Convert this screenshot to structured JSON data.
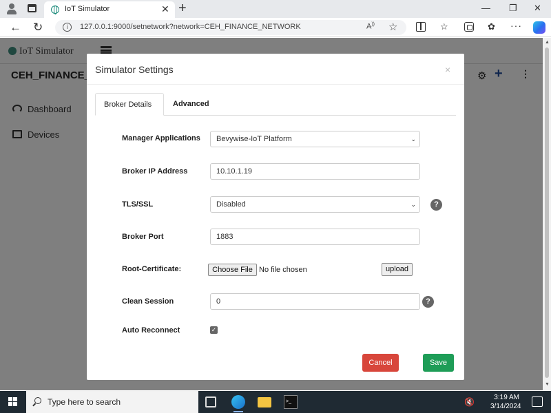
{
  "browser": {
    "tab_title": "IoT Simulator",
    "url": "127.0.0.1:9000/setnetwork?network=CEH_FINANCE_NETWORK",
    "icons": [
      "profile-icon",
      "tab-actions-icon",
      "globe-icon",
      "close-icon",
      "new-tab-icon",
      "minimize-icon",
      "maximize-icon",
      "window-close-icon",
      "back-icon",
      "refresh-icon",
      "site-info-icon",
      "read-aloud-icon",
      "favorite-star-icon",
      "split-screen-icon",
      "favorites-icon",
      "collections-icon",
      "extensions-icon",
      "more-icon",
      "copilot-icon"
    ]
  },
  "app": {
    "logo": "IoT Simulator",
    "network_title": "CEH_FINANCE_",
    "sidebar": [
      {
        "label": "Dashboard",
        "icon": "dashboard-icon"
      },
      {
        "label": "Devices",
        "icon": "monitor-icon"
      }
    ]
  },
  "modal": {
    "title": "Simulator Settings",
    "close": "×",
    "tabs": [
      {
        "label": "Broker Details",
        "active": true
      },
      {
        "label": "Advanced",
        "active": false
      }
    ],
    "fields": {
      "manager_label": "Manager Applications",
      "manager_value": "Bevywise-IoT Platform",
      "broker_ip_label": "Broker IP Address",
      "broker_ip_value": "10.10.1.19",
      "tls_label": "TLS/SSL",
      "tls_value": "Disabled",
      "port_label": "Broker Port",
      "port_value": "1883",
      "root_cert_label": "Root-Certificate:",
      "choose_file": "Choose File",
      "no_file": "No file chosen",
      "upload": "upload",
      "clean_session_label": "Clean Session",
      "clean_session_value": "0",
      "auto_reconnect_label": "Auto Reconnect",
      "auto_reconnect_checked": true,
      "help": "?"
    },
    "buttons": {
      "cancel": "Cancel",
      "save": "Save"
    },
    "colors": {
      "cancel": "#d8463b",
      "save": "#1e9d57"
    }
  },
  "taskbar": {
    "search_placeholder": "Type here to search",
    "time": "3:19 AM",
    "date": "3/14/2024"
  }
}
